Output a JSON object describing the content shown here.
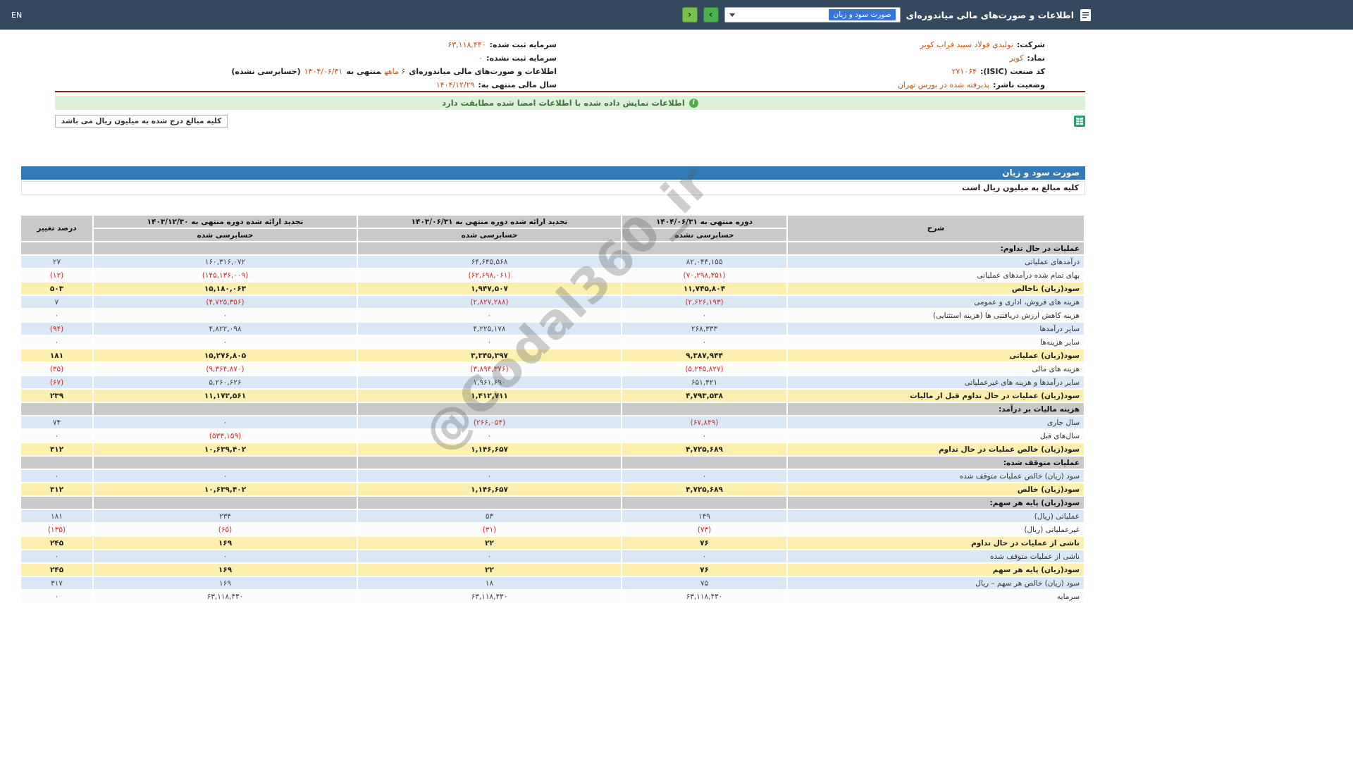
{
  "topbar": {
    "en_label": "EN",
    "title": "اطلاعات و صورت‌های مالی میاندوره‌ای",
    "dropdown_value": "صورت سود و زیان",
    "next_button": "›",
    "prev_button": "‹"
  },
  "company_info": {
    "rows": [
      {
        "right": [
          {
            "t": "شرکت:",
            "c": "lbl"
          },
          {
            "t": "تولیدي فولاد سپید فراب کویر",
            "c": "val"
          }
        ],
        "left": [
          {
            "t": "سرمایه ثبت شده:",
            "c": "lbl"
          },
          {
            "t": "۶۳,۱۱۸,۴۴۰",
            "c": "val"
          }
        ]
      },
      {
        "right": [
          {
            "t": "نماد:",
            "c": "lbl"
          },
          {
            "t": "کویر",
            "c": "val"
          }
        ],
        "left": [
          {
            "t": "سرمایه ثبت نشده:",
            "c": "lbl"
          },
          {
            "t": "۰",
            "c": "val"
          }
        ]
      },
      {
        "right": [
          {
            "t": "کد صنعت (ISIC):",
            "c": "lbl"
          },
          {
            "t": "۲۷۱۰۶۴",
            "c": "val"
          }
        ],
        "left": [
          {
            "t": "اطلاعات و صورت‌های مالی میاندوره‌ای",
            "c": "lbl"
          },
          {
            "t": "۶ ماهه",
            "c": "val"
          },
          {
            "t": "منتهی به",
            "c": "lbl"
          },
          {
            "t": "۱۴۰۴/۰۶/۳۱",
            "c": "val"
          },
          {
            "t": "(حسابرسی نشده)",
            "c": "lbl"
          }
        ]
      },
      {
        "right": [
          {
            "t": "وضعیت ناشر:",
            "c": "lbl"
          },
          {
            "t": "پذیرفته شده در بورس تهران",
            "c": "val"
          }
        ],
        "left": [
          {
            "t": "سال مالی منتهی به:",
            "c": "lbl"
          },
          {
            "t": "۱۴۰۴/۱۲/۲۹",
            "c": "val"
          }
        ]
      }
    ]
  },
  "signature_banner": {
    "icon": "i",
    "text": "اطلاعات نمایش داده شده با اطلاعات امضا شده مطابقت دارد"
  },
  "units_note": {
    "text": "کلیه مبالغ درج شده به میلیون ریال می باشد"
  },
  "statement": {
    "title": "صورت سود و زیان",
    "subtitle": "کلیه مبالغ به میلیون ریال است"
  },
  "watermark": "@Codal360_ir",
  "colors": {
    "topbar": "#34495e",
    "accent_blue": "#337ab7",
    "row_blue": "#d9e7f6",
    "row_yellow": "#fcefaf",
    "header_gray": "#c9c9c9",
    "negative_red": "#c9302c",
    "value_orange": "#c3571e",
    "banner_green": "#dff0d8",
    "button_green": "#4caf50",
    "divider_maroon": "#8e1f1f"
  },
  "table": {
    "headers": {
      "desc": "شرح",
      "cols": [
        {
          "title": "دوره منتهی به ۱۴۰۴/۰۶/۳۱",
          "sub": "حسابرسی نشده"
        },
        {
          "title": "تجدید ارائه شده دوره منتهی به ۱۴۰۳/۰۶/۳۱",
          "sub": "حسابرسی شده"
        },
        {
          "title": "تجدید ارائه شده دوره منتهی به ۱۴۰۳/۱۲/۳۰",
          "sub": "حسابرسی شده"
        }
      ],
      "change": "درصد تغییر"
    },
    "rows": [
      {
        "type": "section",
        "desc": "عملیات در حال تداوم:"
      },
      {
        "type": "data",
        "bg": "blue",
        "desc": "درآمدهای عملیاتی",
        "v": [
          "۸۲,۰۴۴,۱۵۵",
          "۶۴,۶۴۵,۵۶۸",
          "۱۶۰,۳۱۶,۰۷۲",
          "۲۷"
        ]
      },
      {
        "type": "data",
        "bg": "white",
        "desc": "بهای تمام شده درآمدهای عملیاتی",
        "v": [
          "(۷۰,۲۹۸,۳۵۱)",
          "(۶۲,۶۹۸,۰۶۱)",
          "(۱۴۵,۱۳۶,۰۰۹)",
          "(۱۲)"
        ]
      },
      {
        "type": "data",
        "bg": "yellow",
        "desc": "سود(زیان) ناخالص",
        "v": [
          "۱۱,۷۴۵,۸۰۴",
          "۱,۹۴۷,۵۰۷",
          "۱۵,۱۸۰,۰۶۳",
          "۵۰۳"
        ]
      },
      {
        "type": "data",
        "bg": "blue",
        "desc": "هزینه های فروش، اداری و عمومی",
        "v": [
          "(۲,۶۲۶,۱۹۳)",
          "(۲,۸۲۷,۲۸۸)",
          "(۴,۷۲۵,۳۵۶)",
          "۷"
        ]
      },
      {
        "type": "data",
        "bg": "white",
        "desc": "هزینه کاهش ارزش دریافتنی ها (هزینه استثنایی)",
        "v": [
          "۰",
          "۰",
          "۰",
          "۰"
        ]
      },
      {
        "type": "data",
        "bg": "blue",
        "desc": "سایر درآمدها",
        "v": [
          "۲۶۸,۳۳۳",
          "۴,۲۲۵,۱۷۸",
          "۴,۸۲۲,۰۹۸",
          "(۹۴)"
        ]
      },
      {
        "type": "data",
        "bg": "white",
        "desc": "سایر هزینه‌ها",
        "v": [
          "۰",
          "۰",
          "۰",
          "۰"
        ]
      },
      {
        "type": "data",
        "bg": "yellow",
        "desc": "سود(زیان) عملیاتی",
        "v": [
          "۹,۳۸۷,۹۴۴",
          "۳,۳۴۵,۳۹۷",
          "۱۵,۲۷۶,۸۰۵",
          "۱۸۱"
        ]
      },
      {
        "type": "data",
        "bg": "white",
        "desc": "هزینه های مالی",
        "v": [
          "(۵,۲۴۵,۸۲۷)",
          "(۳,۸۹۴,۳۷۶)",
          "(۹,۳۶۴,۸۷۰)",
          "(۳۵)"
        ]
      },
      {
        "type": "data",
        "bg": "blue",
        "desc": "سایر درآمدها و هزینه های غیرعملیاتی",
        "v": [
          "۶۵۱,۴۲۱",
          "۱,۹۶۱,۶۹۰",
          "۵,۲۶۰,۶۲۶",
          "(۶۷)"
        ]
      },
      {
        "type": "data",
        "bg": "yellow",
        "desc": "سود(زیان) عملیات در حال تداوم قبل از مالیات",
        "v": [
          "۴,۷۹۳,۵۳۸",
          "۱,۴۱۲,۷۱۱",
          "۱۱,۱۷۲,۵۶۱",
          "۲۳۹"
        ]
      },
      {
        "type": "section",
        "desc": "هزینه مالیات بر درآمد:"
      },
      {
        "type": "data",
        "bg": "blue",
        "desc": "سال جاری",
        "v": [
          "(۶۷,۸۴۹)",
          "(۲۶۶,۰۵۴)",
          "۰",
          "۷۴"
        ]
      },
      {
        "type": "data",
        "bg": "white",
        "desc": "سال‌های قبل",
        "v": [
          "۰",
          "۰",
          "(۵۳۳,۱۵۹)",
          "۰"
        ]
      },
      {
        "type": "data",
        "bg": "yellow",
        "desc": "سود(زیان) خالص عملیات در حال تداوم",
        "v": [
          "۴,۷۲۵,۶۸۹",
          "۱,۱۴۶,۶۵۷",
          "۱۰,۶۳۹,۴۰۲",
          "۳۱۲"
        ]
      },
      {
        "type": "section",
        "desc": "عملیات متوقف شده:"
      },
      {
        "type": "data",
        "bg": "blue",
        "desc": "سود (زیان) خالص عملیات متوقف شده",
        "v": [
          "۰",
          "۰",
          "۰",
          "۰"
        ]
      },
      {
        "type": "data",
        "bg": "yellow",
        "desc": "سود(زیان) خالص",
        "v": [
          "۴,۷۲۵,۶۸۹",
          "۱,۱۴۶,۶۵۷",
          "۱۰,۶۳۹,۴۰۲",
          "۳۱۲"
        ]
      },
      {
        "type": "section",
        "desc": "سود(زیان) پایه هر سهم:"
      },
      {
        "type": "data",
        "bg": "blue",
        "desc": "عملیاتی (ریال)",
        "v": [
          "۱۴۹",
          "۵۳",
          "۲۳۴",
          "۱۸۱"
        ]
      },
      {
        "type": "data",
        "bg": "white",
        "desc": "غیرعملیاتی (ریال)",
        "v": [
          "(۷۳)",
          "(۳۱)",
          "(۶۵)",
          "(۱۳۵)"
        ]
      },
      {
        "type": "data",
        "bg": "yellow",
        "desc": "ناشی از عملیات در حال تداوم",
        "v": [
          "۷۶",
          "۲۲",
          "۱۶۹",
          "۲۴۵"
        ]
      },
      {
        "type": "data",
        "bg": "blue",
        "desc": "ناشی از عملیات متوقف شده",
        "v": [
          "۰",
          "۰",
          "۰",
          "۰"
        ]
      },
      {
        "type": "data",
        "bg": "yellow",
        "desc": "سود(زیان) پایه هر سهم",
        "v": [
          "۷۶",
          "۲۲",
          "۱۶۹",
          "۲۴۵"
        ]
      },
      {
        "type": "data",
        "bg": "blue",
        "desc": "سود (زیان) خالص هر سهم – ریال",
        "v": [
          "۷۵",
          "۱۸",
          "۱۶۹",
          "۳۱۷"
        ]
      },
      {
        "type": "data",
        "bg": "white",
        "desc": "سرمایه",
        "v": [
          "۶۳,۱۱۸,۴۴۰",
          "۶۳,۱۱۸,۴۴۰",
          "۶۳,۱۱۸,۴۴۰",
          "۰"
        ]
      }
    ]
  }
}
